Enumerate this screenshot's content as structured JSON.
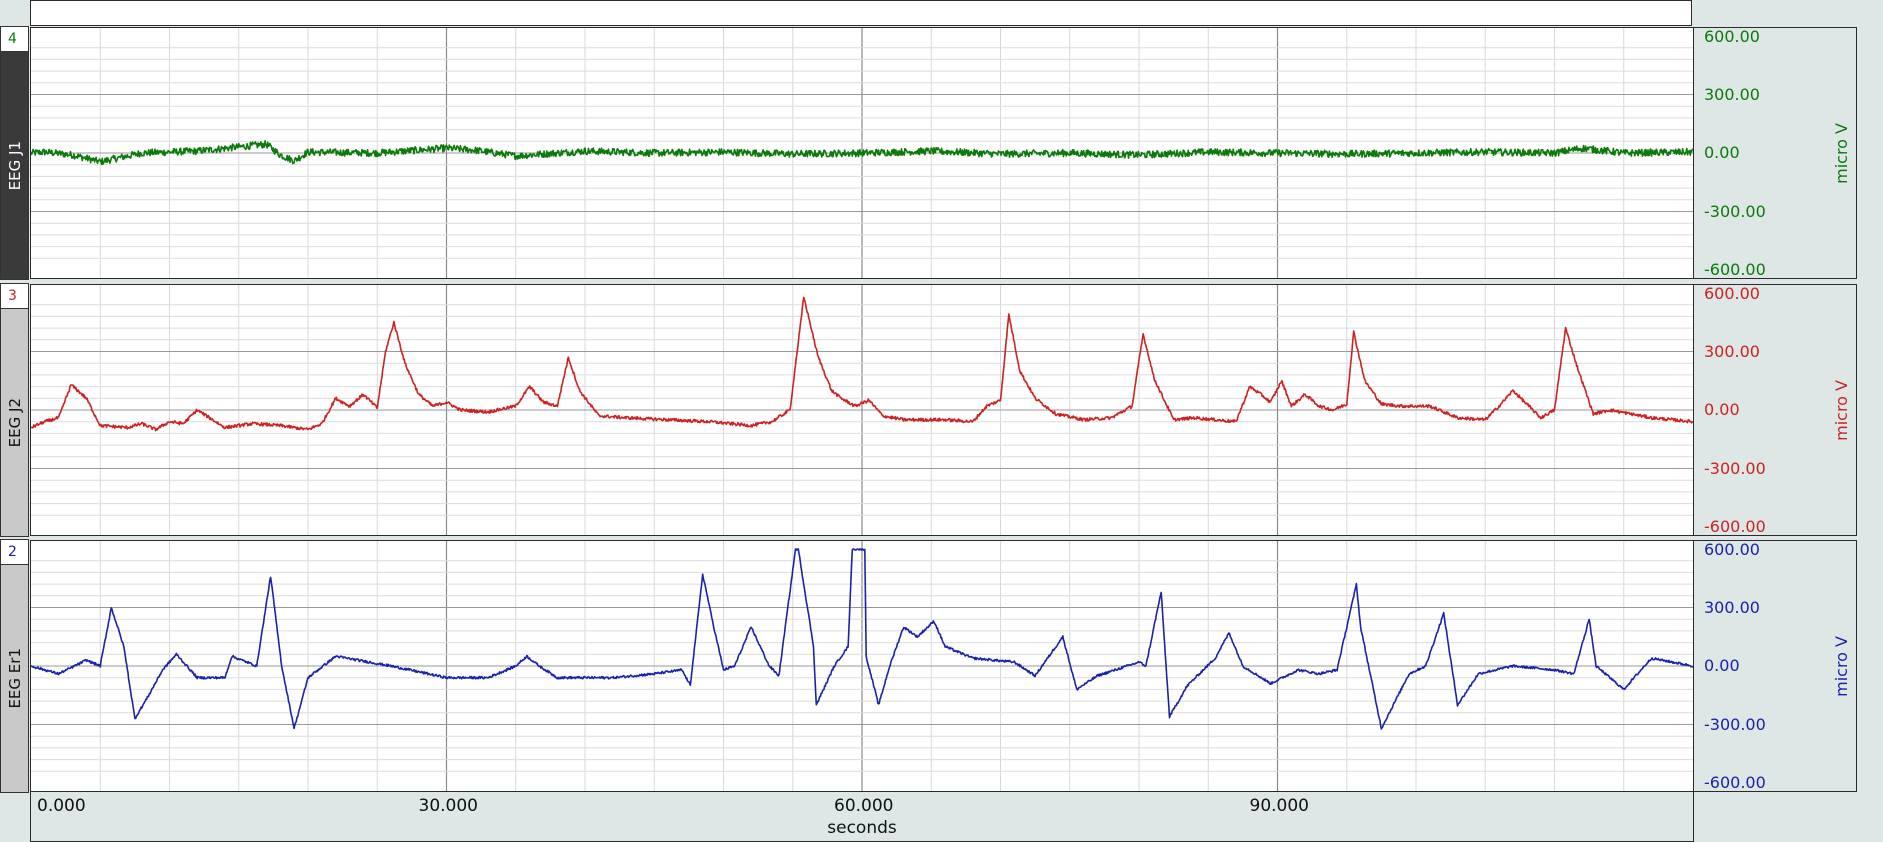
{
  "chart_data": {
    "type": "line",
    "x_range": [
      0,
      120
    ],
    "x_unit": "seconds",
    "x_ticks": [
      "0.000",
      "30.000",
      "60.000",
      "90.000"
    ],
    "x_tick_values": [
      0,
      30,
      60,
      90
    ],
    "y_range": [
      -600,
      600
    ],
    "y_tick_values": [
      600,
      300,
      0,
      -300,
      -600
    ],
    "grid": true,
    "channels": [
      {
        "number": "4",
        "name": "EEG J1",
        "unit": "micro V",
        "color": "#0a7a0a",
        "y_ticks": [
          "600.00",
          "300.00",
          "0.00",
          "-300.00",
          "-600.00"
        ],
        "noise": 18,
        "x": [
          0,
          1,
          3,
          5,
          8,
          12,
          17,
          18,
          19,
          20,
          25,
          30,
          32,
          35,
          40,
          45,
          50,
          55,
          60,
          65,
          70,
          75,
          80,
          85,
          90,
          95,
          100,
          105,
          110,
          112,
          115,
          120
        ],
        "y": [
          0,
          5,
          -10,
          -45,
          0,
          10,
          45,
          -10,
          -40,
          5,
          0,
          25,
          15,
          -15,
          10,
          0,
          5,
          -5,
          0,
          10,
          -5,
          0,
          -10,
          5,
          0,
          -5,
          0,
          5,
          0,
          25,
          0,
          5
        ]
      },
      {
        "number": "3",
        "name": "EEG J2",
        "unit": "micro V",
        "color": "#cc2222",
        "y_ticks": [
          "600.00",
          "300.00",
          "0.00",
          "-300.00",
          "-600.00"
        ],
        "noise": 8,
        "x": [
          0,
          1,
          2,
          2.9,
          4,
          5,
          7,
          8,
          9,
          10,
          11,
          12,
          14,
          16,
          18,
          20,
          21,
          22,
          23,
          24,
          25,
          25.6,
          26.2,
          27,
          28,
          29,
          30,
          31,
          33,
          35,
          36,
          37,
          38,
          38.8,
          39.6,
          41,
          43,
          46,
          49,
          52,
          53.5,
          54.8,
          55.8,
          56.8,
          57.8,
          58.5,
          59.5,
          60.5,
          61.5,
          63,
          66,
          68,
          69,
          70,
          70.6,
          71.4,
          72.5,
          74,
          76,
          78,
          79.5,
          80.3,
          81.1,
          82.5,
          84,
          87,
          88,
          88.8,
          89.5,
          90.3,
          91,
          92,
          93,
          94,
          95,
          95.5,
          96.3,
          97.5,
          99,
          101,
          103,
          105,
          106,
          107,
          109,
          110,
          110.8,
          111.6,
          112.8,
          114,
          117,
          120
        ],
        "y": [
          -90,
          -60,
          -40,
          130,
          60,
          -80,
          -90,
          -70,
          -100,
          -60,
          -70,
          0,
          -90,
          -70,
          -80,
          -100,
          -70,
          60,
          20,
          80,
          10,
          300,
          450,
          240,
          80,
          20,
          40,
          0,
          -10,
          20,
          120,
          40,
          20,
          270,
          100,
          -30,
          -40,
          -50,
          -60,
          -80,
          -60,
          0,
          580,
          280,
          100,
          60,
          20,
          50,
          -30,
          -50,
          -50,
          -60,
          20,
          50,
          490,
          200,
          60,
          -20,
          -50,
          -40,
          20,
          390,
          160,
          -50,
          -40,
          -60,
          120,
          80,
          40,
          150,
          20,
          80,
          20,
          0,
          30,
          400,
          150,
          30,
          20,
          20,
          -40,
          -50,
          20,
          100,
          -40,
          0,
          420,
          230,
          -20,
          0,
          -40,
          -60
        ]
      },
      {
        "number": "2",
        "name": "EEG Er1",
        "unit": "micro V",
        "color": "#1a22aa",
        "y_ticks": [
          "600.00",
          "300.00",
          "0.00",
          "-300.00",
          "-600.00"
        ],
        "noise": 6,
        "x": [
          0,
          2,
          4,
          5,
          5.8,
          6.7,
          7.5,
          8.5,
          9.5,
          10.5,
          12,
          14,
          14.5,
          16.3,
          17.3,
          18.1,
          19,
          20,
          22,
          26,
          30,
          33,
          35,
          35.8,
          36.7,
          38,
          42,
          45,
          47,
          47.6,
          48.5,
          49.3,
          50,
          50.8,
          52,
          53.3,
          54,
          55.2,
          55.4,
          56.5,
          56.7,
          58,
          59,
          59.3,
          60.2,
          60.3,
          61.2,
          62,
          63,
          64,
          65.2,
          66,
          68,
          71,
          72.5,
          73,
          74.5,
          75.5,
          77,
          80,
          80.5,
          81.6,
          82.2,
          83.5,
          85.5,
          86.5,
          87.5,
          89.5,
          91.5,
          93,
          94.3,
          95.7,
          96,
          97.5,
          99.5,
          100.7,
          102,
          103,
          104.5,
          107,
          110,
          111.4,
          112.5,
          113,
          115,
          117,
          120
        ],
        "y": [
          0,
          -40,
          30,
          0,
          300,
          100,
          -270,
          -150,
          -20,
          60,
          -60,
          -60,
          50,
          0,
          460,
          0,
          -320,
          -60,
          50,
          0,
          -60,
          -60,
          0,
          50,
          0,
          -60,
          -60,
          -40,
          -20,
          -100,
          470,
          200,
          -20,
          0,
          200,
          0,
          -50,
          600,
          600,
          100,
          -200,
          0,
          100,
          600,
          600,
          50,
          -200,
          0,
          200,
          150,
          230,
          100,
          40,
          20,
          -50,
          0,
          150,
          -120,
          -50,
          20,
          0,
          380,
          -260,
          -100,
          40,
          170,
          0,
          -90,
          -20,
          -40,
          -20,
          420,
          200,
          -320,
          -40,
          0,
          270,
          -200,
          -40,
          0,
          -20,
          -40,
          240,
          0,
          -120,
          40,
          0
        ]
      }
    ]
  }
}
